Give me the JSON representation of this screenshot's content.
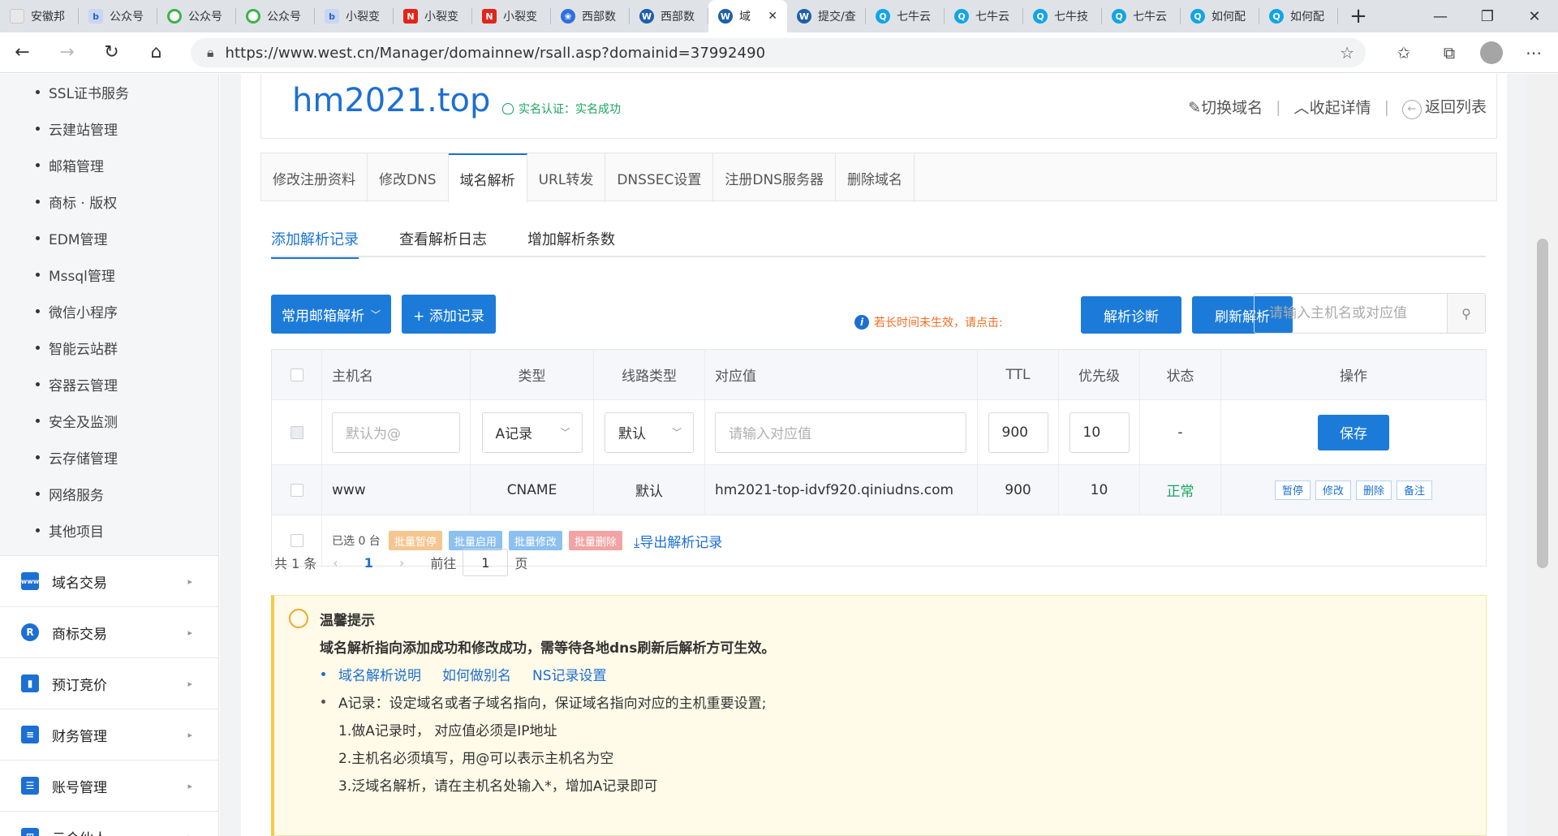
{
  "browser": {
    "tabs": [
      {
        "label": "安徽邦",
        "icon": "doc"
      },
      {
        "label": "公众号",
        "icon": "baidu"
      },
      {
        "label": "公众号",
        "icon": "wechat"
      },
      {
        "label": "公众号",
        "icon": "wechat"
      },
      {
        "label": "小裂变",
        "icon": "baidu"
      },
      {
        "label": "小裂变",
        "icon": "red"
      },
      {
        "label": "小裂变",
        "icon": "red"
      },
      {
        "label": "西部数",
        "icon": "paw"
      },
      {
        "label": "西部数",
        "icon": "west"
      },
      {
        "label": "域",
        "icon": "west",
        "active": true
      },
      {
        "label": "提交/查",
        "icon": "west"
      },
      {
        "label": "七牛云",
        "icon": "qiniu"
      },
      {
        "label": "七牛云",
        "icon": "qiniu"
      },
      {
        "label": "七牛技",
        "icon": "qiniu"
      },
      {
        "label": "七牛云",
        "icon": "qiniu"
      },
      {
        "label": "如何配",
        "icon": "qiniu"
      },
      {
        "label": "如何配",
        "icon": "qiniu"
      }
    ],
    "url": "https://www.west.cn/Manager/domainnew/rsall.asp?domainid=37992490"
  },
  "sidebar": {
    "sub_items": [
      "SSL证书服务",
      "云建站管理",
      "邮箱管理",
      "商标 · 版权",
      "EDM管理",
      "Mssql管理",
      "微信小程序",
      "智能云站群",
      "容器云管理",
      "安全及监测",
      "云存储管理",
      "网络服务",
      "其他项目"
    ],
    "main_items": [
      {
        "label": "域名交易",
        "icon": "globe-icon",
        "color": "#1c6fd3"
      },
      {
        "label": "商标交易",
        "icon": "trademark-icon",
        "color": "#1c6fd3"
      },
      {
        "label": "预订竞价",
        "icon": "bar-chart-icon",
        "color": "#1c6fd3"
      },
      {
        "label": "财务管理",
        "icon": "finance-icon",
        "color": "#1c6fd3"
      },
      {
        "label": "账号管理",
        "icon": "account-icon",
        "color": "#1c6fd3"
      },
      {
        "label": "云合伙人",
        "icon": "partner-icon",
        "color": "#1c6fd3"
      }
    ]
  },
  "domain": {
    "name": "hm2021.top",
    "realname": "实名认证：实名成功",
    "actions": {
      "switch": "切换域名",
      "collapse": "收起详情",
      "back": "返回列表"
    }
  },
  "tabs": [
    "修改注册资料",
    "修改DNS",
    "域名解析",
    "URL转发",
    "DNSSEC设置",
    "注册DNS服务器",
    "删除域名"
  ],
  "active_tab": 2,
  "subtabs": [
    "添加解析记录",
    "查看解析日志",
    "增加解析条数"
  ],
  "toolbar": {
    "mail_btn": "常用邮箱解析",
    "add_btn": "+ 添加记录",
    "warn": "若长时间未生效，请点击:",
    "diag_btn": "解析诊断",
    "refresh_btn": "刷新解析",
    "search_placeholder": "请输入主机名或对应值"
  },
  "table": {
    "headers": {
      "host": "主机名",
      "type": "类型",
      "line": "线路类型",
      "value": "对应值",
      "ttl": "TTL",
      "priority": "优先级",
      "status": "状态",
      "ops": "操作"
    },
    "edit_row": {
      "host_placeholder": "默认为@",
      "type": "A记录",
      "line": "默认",
      "value_placeholder": "请输入对应值",
      "ttl": "900",
      "priority": "10",
      "status": "-",
      "save": "保存"
    },
    "records": [
      {
        "host": "www",
        "type": "CNAME",
        "line": "默认",
        "value": "hm2021-top-idvf920.qiniudns.com",
        "ttl": "900",
        "priority": "10",
        "status": "正常",
        "ops": [
          "暂停",
          "修改",
          "删除",
          "备注"
        ]
      }
    ],
    "batch": {
      "selected": "已选 0 台",
      "pause": "批量暂停",
      "enable": "批量启用",
      "modify": "批量修改",
      "delete": "批量删除",
      "export": "导出解析记录"
    }
  },
  "pager": {
    "total": "共 1 条",
    "current": "1",
    "goto": "前往",
    "goto_value": "1",
    "page": "页"
  },
  "tips": {
    "title": "温馨提示",
    "lead": "域名解析指向添加成功和修改成功，需等待各地dns刷新后解析方可生效。",
    "links": [
      "域名解析说明",
      "如何做别名",
      "NS记录设置"
    ],
    "a_record": "A记录：设定域名或者子域名指向，保证域名指向对应的主机重要设置;",
    "lines": [
      "1.做A记录时， 对应值必须是IP地址",
      "2.主机名必须填写，用@可以表示主机名为空",
      "3.泛域名解析，请在主机名处输入*，增加A记录即可"
    ]
  },
  "colors": {
    "accent": "#1c7bd9",
    "ok": "#19a55c",
    "warn": "#f06b1f",
    "tag_pause": "#f5c690",
    "tag_enable": "#8cc0ef",
    "tag_modify": "#8cc0ef",
    "tag_delete": "#f2a3a3"
  }
}
